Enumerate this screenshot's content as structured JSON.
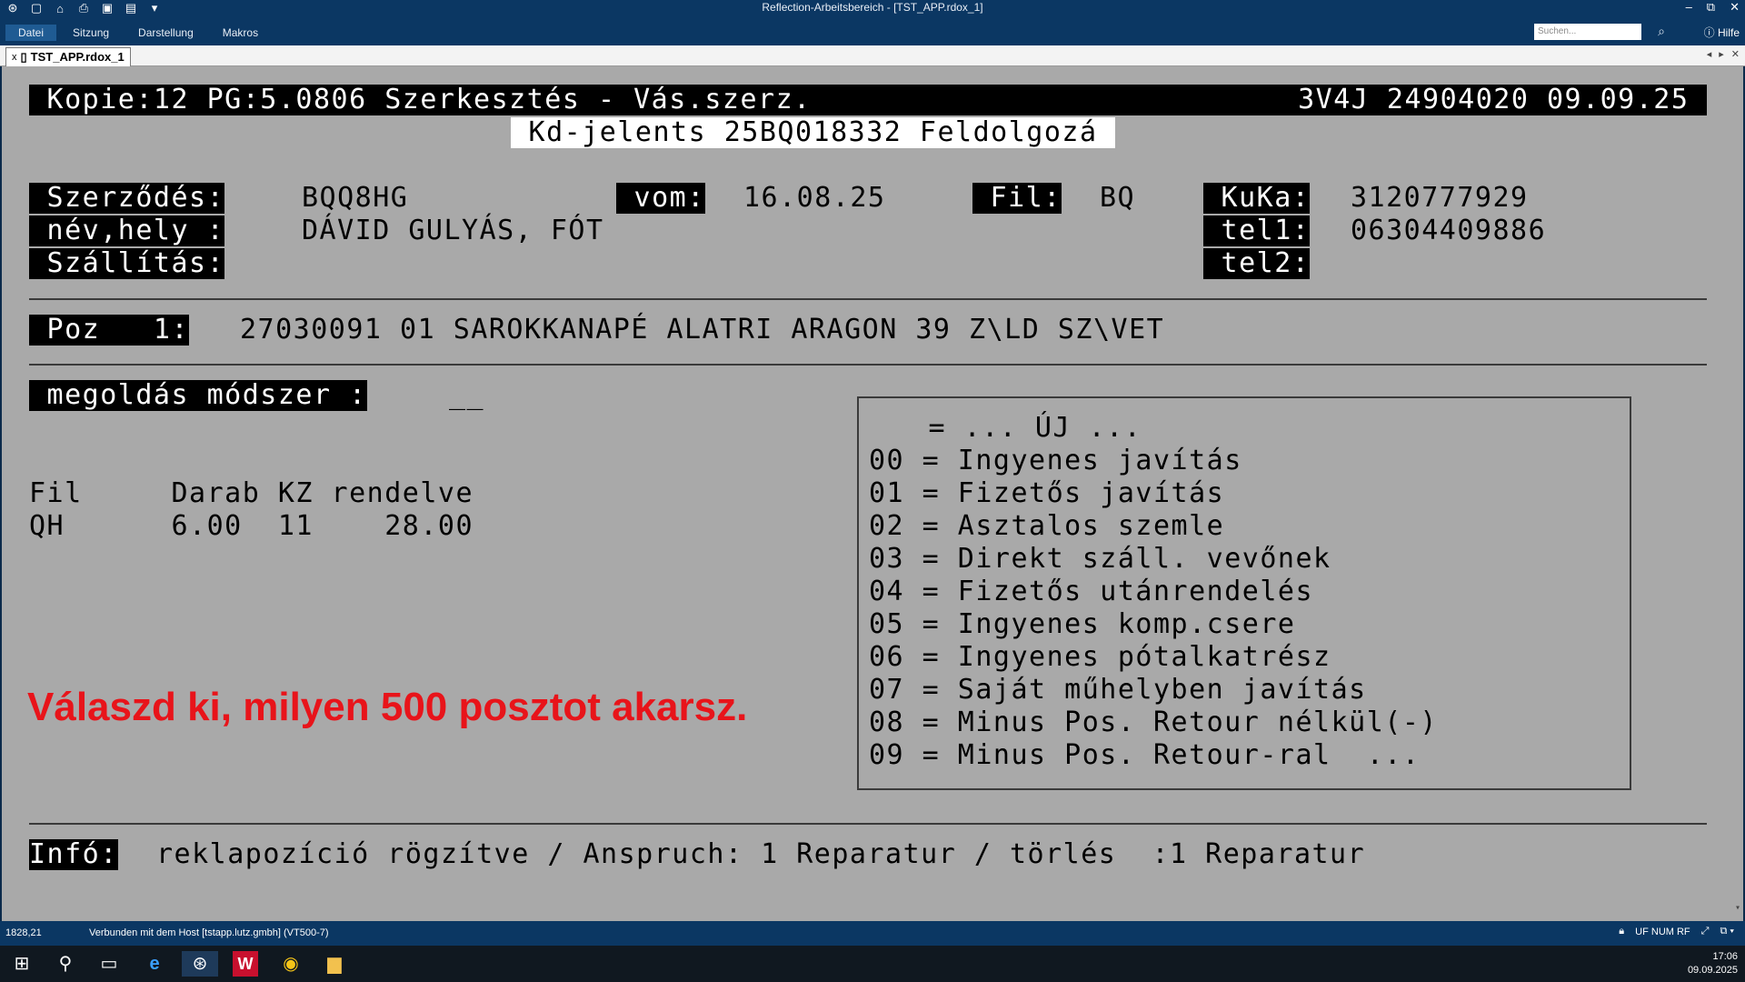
{
  "titlebar": {
    "title": "Reflection-Arbeitsbereich - [TST_APP.rdox_1]",
    "quick_access": [
      "⊛",
      "▢",
      "⌂",
      "⎙",
      "▣",
      "▤",
      "▾"
    ],
    "window_controls": [
      "–",
      "⧉",
      "✕"
    ],
    "ribbon_tabs": [
      "Datei",
      "Sitzung",
      "Darstellung",
      "Makros"
    ],
    "search_placeholder": "Suchen...",
    "help_label": "Hilfe"
  },
  "docbar": {
    "close": "x",
    "tab_label": "TST_APP.rdox_1",
    "nav": [
      "◂",
      "▸",
      "✕"
    ]
  },
  "terminal": {
    "header_left": " Kopie:12 PG:5.0806 Szerkesztés - Vás.szerz. ",
    "header_right": " 3V4J 24904020 09.09.25 ",
    "subtitle": " Kd-jelents 25BQ018332 Feldolgozá ",
    "labels": {
      "contract": " Szerződés:",
      "name": " név,hely :",
      "delivery": " Szállítás:",
      "vom": " vom:",
      "fil": " Fil:",
      "kuka": " KuKa:",
      "tel1": " tel1:",
      "tel2": " tel2:"
    },
    "values": {
      "contract": "BQQ8HG",
      "name": "DÁVID GULYÁS, FÓT",
      "vom": "16.08.25",
      "fil": "BQ",
      "kuka": "3120777929",
      "tel1": "06304409886"
    },
    "position": {
      "label": " Poz   1:",
      "value": "27030091 01 SAROKKANAPÉ ALATRI ARAGON 39 Z\\LD SZ\\VET"
    },
    "method": {
      "label": " megoldás módszer :",
      "value": "__"
    },
    "table": {
      "header": "Fil     Darab KZ rendelve",
      "row": "QH      6.00  11    28.00"
    },
    "options": [
      " = ... ÚJ ...",
      "00 = Ingyenes javítás",
      "01 = Fizetős javítás",
      "02 = Asztalos szemle",
      "03 = Direkt száll. vevőnek",
      "04 = Fizetős utánrendelés",
      "05 = Ingyenes komp.csere",
      "06 = Ingyenes pótalkatrész",
      "07 = Saját műhelyben javítás",
      "08 = Minus Pos. Retour nélkül(-)",
      "09 = Minus Pos. Retour-ral  ..."
    ],
    "info": {
      "label": "Infó:",
      "value": "reklapozíció rögzítve / Anspruch: 1 Reparatur / törlés  :1 Reparatur"
    }
  },
  "hint": "Válaszd ki, milyen 500 posztot akarsz.",
  "statusbar": {
    "cursor": "1828,21",
    "connection": "Verbunden mit dem Host [tstapp.lutz.gmbh] (VT500-7)",
    "indicators": "UF NUM RF"
  },
  "taskbar": {
    "time": "17:06",
    "date": "09.09.2025"
  }
}
